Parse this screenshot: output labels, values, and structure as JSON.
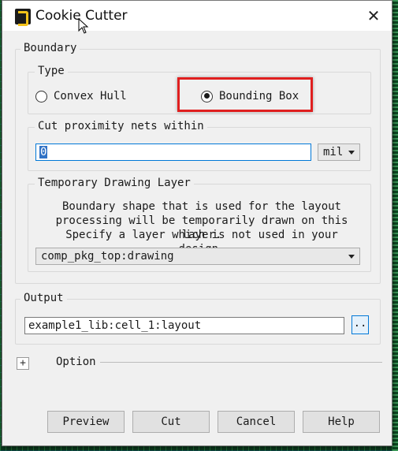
{
  "window": {
    "title": "Cookie Cutter",
    "close_glyph": "✕"
  },
  "boundary": {
    "legend": "Boundary",
    "type": {
      "legend": "Type",
      "options": [
        "Convex Hull",
        "Bounding Box"
      ],
      "selected": "Bounding Box"
    },
    "proximity": {
      "legend": "Cut proximity nets within",
      "value": "0",
      "unit": "mil"
    },
    "temp_layer": {
      "legend": "Temporary Drawing Layer",
      "description": [
        "Boundary shape that is used for the layout",
        "processing will be temporarily drawn on this layer.",
        "Specify a layer which is not used in your design."
      ],
      "layer": "comp_pkg_top:drawing"
    }
  },
  "output": {
    "legend": "Output",
    "value": "example1_lib:cell_1:layout",
    "browse_label": ".."
  },
  "option": {
    "expander": "+",
    "label": "Option"
  },
  "buttons": {
    "preview": "Preview",
    "cut": "Cut",
    "cancel": "Cancel",
    "help": "Help"
  },
  "colors": {
    "highlight": "#e01f1f",
    "focus": "#0078d7"
  }
}
